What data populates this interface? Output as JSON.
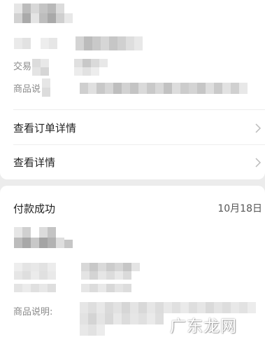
{
  "top_card": {
    "transaction_label": "交易",
    "product_label": "商品说",
    "view_order_details": "查看订单详情",
    "view_details": "查看详情"
  },
  "bottom_card": {
    "status_title": "付款成功",
    "date": "10月18日",
    "product_desc_label": "商品说明:"
  },
  "watermark": "广东龙网",
  "colors": {
    "card_bg": "#ffffff",
    "page_bg": "#ececec",
    "primary_text": "#222222",
    "secondary_text": "#8a8a8a",
    "chevron": "#bbbbbb"
  },
  "icons": {
    "chevron": "chevron-right-icon"
  }
}
